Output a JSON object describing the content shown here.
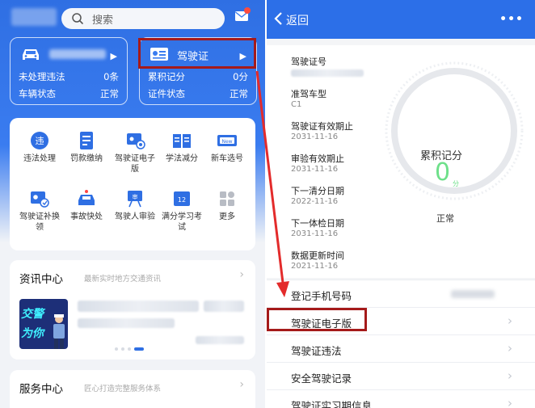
{
  "left": {
    "search_placeholder": "搜索",
    "car_card": {
      "violations_label": "未处理违法",
      "violations_value": "0条",
      "status_label": "车辆状态",
      "status_value": "正常"
    },
    "license_card": {
      "title": "驾驶证",
      "points_label": "累积记分",
      "points_value": "0分",
      "status_label": "证件状态",
      "status_value": "正常"
    },
    "services": [
      {
        "label": "违法处理",
        "icon": "violation-icon"
      },
      {
        "label": "罚款缴纳",
        "icon": "fine-icon"
      },
      {
        "label": "驾驶证电子版",
        "icon": "e-license-icon"
      },
      {
        "label": "学法减分",
        "icon": "study-icon"
      },
      {
        "label": "新车选号",
        "icon": "new-plate-icon"
      },
      {
        "label": "驾驶证补换领",
        "icon": "license-renew-icon"
      },
      {
        "label": "事故快处",
        "icon": "accident-icon"
      },
      {
        "label": "驾驶人审验",
        "icon": "driver-review-icon"
      },
      {
        "label": "满分学习考试",
        "icon": "exam-icon"
      },
      {
        "label": "更多",
        "icon": "more-icon"
      }
    ],
    "news": {
      "title": "资讯中心",
      "subtitle": "最新实时地方交通资讯",
      "image_text_1": "交警",
      "image_text_2": "为你"
    },
    "service_center": {
      "title": "服务中心",
      "subtitle": "匠心打造完整服务体系"
    }
  },
  "right": {
    "back_label": "返回",
    "more_label": "•••",
    "fields": [
      {
        "label": "驾驶证号",
        "value": ""
      },
      {
        "label": "准驾车型",
        "value": "C1"
      },
      {
        "label": "驾驶证有效期止",
        "value": "2031-11-16"
      },
      {
        "label": "审验有效期止",
        "value": "2031-11-16"
      },
      {
        "label": "下一清分日期",
        "value": "2022-11-16"
      },
      {
        "label": "下一体检日期",
        "value": "2031-11-16"
      },
      {
        "label": "数据更新时间",
        "value": "2021-11-16"
      }
    ],
    "gauge": {
      "title": "累积记分",
      "value": "0",
      "unit": "分",
      "status": "正常"
    },
    "menu": [
      {
        "label": "登记手机号码"
      },
      {
        "label": "驾驶证电子版"
      },
      {
        "label": "驾驶证违法"
      },
      {
        "label": "安全驾驶记录"
      },
      {
        "label": "驾驶证实习期信息"
      }
    ]
  },
  "colors": {
    "brand_blue": "#2c6fe8",
    "highlight_red": "#a51a1a",
    "gauge_green": "#6ee08a"
  }
}
